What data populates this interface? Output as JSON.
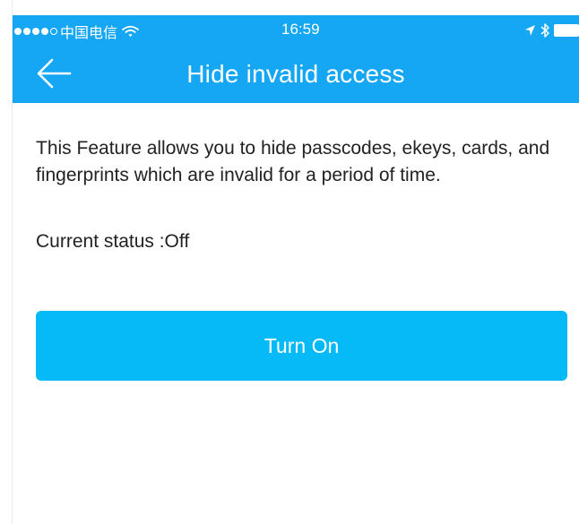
{
  "status_bar": {
    "signal_filled_dots": 4,
    "signal_total_dots": 5,
    "carrier": "中国电信",
    "time": "16:59",
    "icons": [
      "wifi-icon",
      "location-arrow-icon",
      "bluetooth-icon",
      "battery-icon"
    ]
  },
  "nav": {
    "back_icon": "arrow-left-icon",
    "title": "Hide invalid access"
  },
  "content": {
    "description": "This Feature allows you to hide passcodes, ekeys, cards, and fingerprints which are invalid for a period of time.",
    "status_text": "Current status :Off",
    "button_label": "Turn On"
  },
  "colors": {
    "header_bg": "#15a6f4",
    "button_bg": "#06baf7",
    "text": "#222222"
  }
}
